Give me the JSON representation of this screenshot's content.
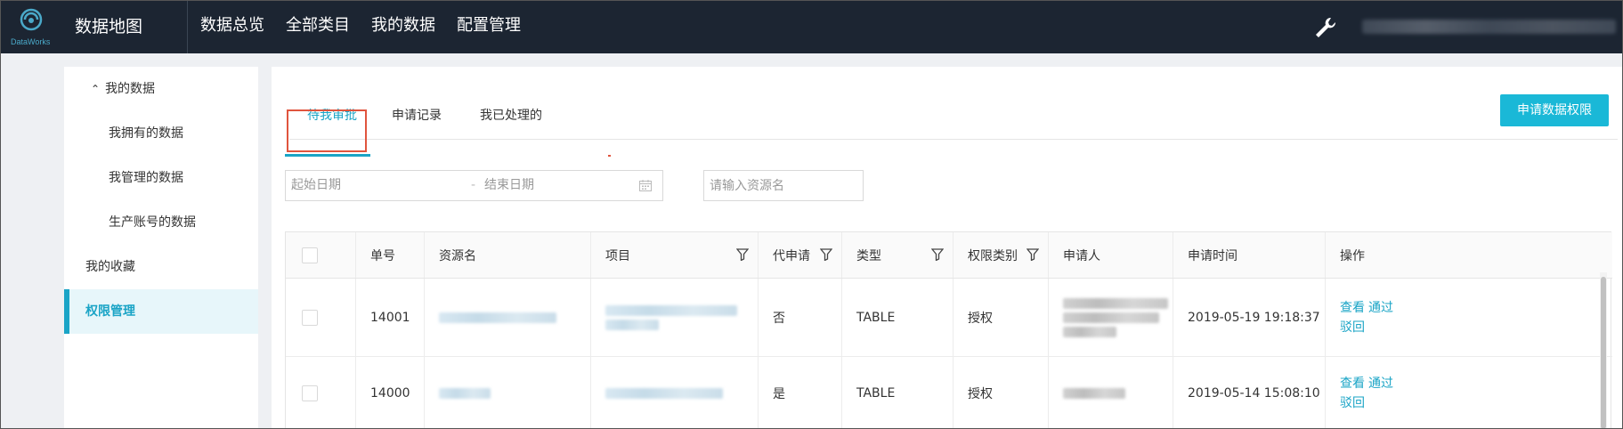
{
  "header": {
    "logo_text": "DataWorks",
    "app_title": "数据地图",
    "nav": [
      "数据总览",
      "全部类目",
      "我的数据",
      "配置管理"
    ]
  },
  "sidebar": {
    "group_label": "我的数据",
    "items": [
      {
        "label": "我拥有的数据"
      },
      {
        "label": "我管理的数据"
      },
      {
        "label": "生产账号的数据"
      }
    ],
    "favorites": "我的收藏",
    "permission": "权限管理"
  },
  "main": {
    "tabs": [
      "待我审批",
      "申请记录",
      "我已处理的"
    ],
    "active_tab": "待我审批",
    "apply_button": "申请数据权限",
    "date_start_placeholder": "起始日期",
    "date_separator": "-",
    "date_end_placeholder": "结束日期",
    "resource_placeholder": "请输入资源名"
  },
  "table": {
    "columns": [
      "单号",
      "资源名",
      "项目",
      "代申请",
      "类型",
      "权限类别",
      "申请人",
      "申请时间",
      "操作"
    ],
    "rows": [
      {
        "id": "14001",
        "proxy": "否",
        "type": "TABLE",
        "perm": "授权",
        "time": "2019-05-19 19:18:37",
        "op_view": "查看",
        "op_pass": "通过",
        "op_reject": "驳回"
      },
      {
        "id": "14000",
        "proxy": "是",
        "type": "TABLE",
        "perm": "授权",
        "time": "2019-05-14 15:08:10",
        "op_view": "查看",
        "op_pass": "通过",
        "op_reject": "驳回"
      }
    ]
  },
  "colors": {
    "topbar": "#1c2532",
    "accent": "#1aa4c6",
    "button": "#1ab8d7",
    "highlight_box": "#e0553e"
  }
}
